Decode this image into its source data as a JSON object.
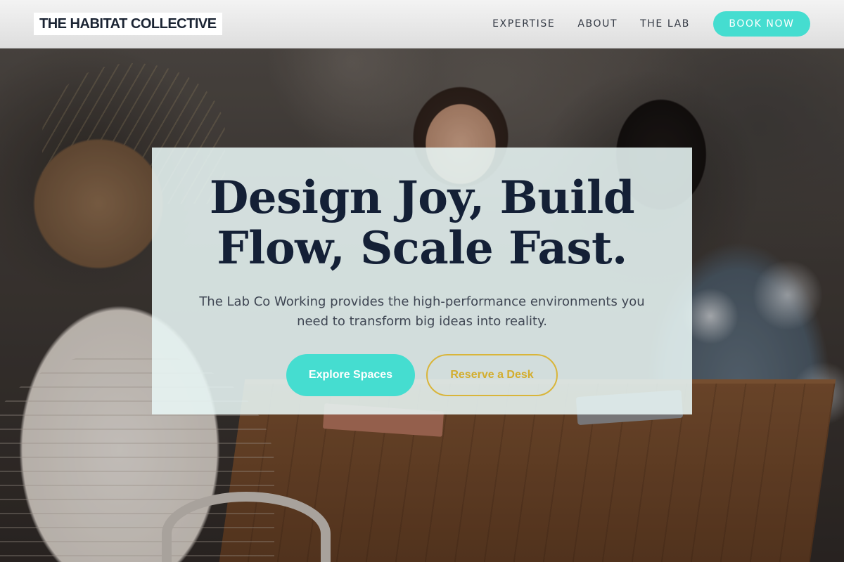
{
  "header": {
    "logo": "THE HABITAT COLLECTIVE",
    "nav": [
      {
        "label": "EXPERTISE"
      },
      {
        "label": "ABOUT"
      },
      {
        "label": "THE LAB"
      }
    ],
    "cta_label": "BOOK NOW"
  },
  "hero": {
    "title_line1": "Design Joy, Build",
    "title_line2": "Flow, Scale Fast.",
    "subtitle": "The Lab Co Working provides the high-performance environments you need to transform big ideas into reality.",
    "primary_button": "Explore Spaces",
    "secondary_button": "Reserve a Desk"
  },
  "colors": {
    "accent": "#45ddd0",
    "gold": "#d9b53a",
    "heading": "#142036"
  }
}
